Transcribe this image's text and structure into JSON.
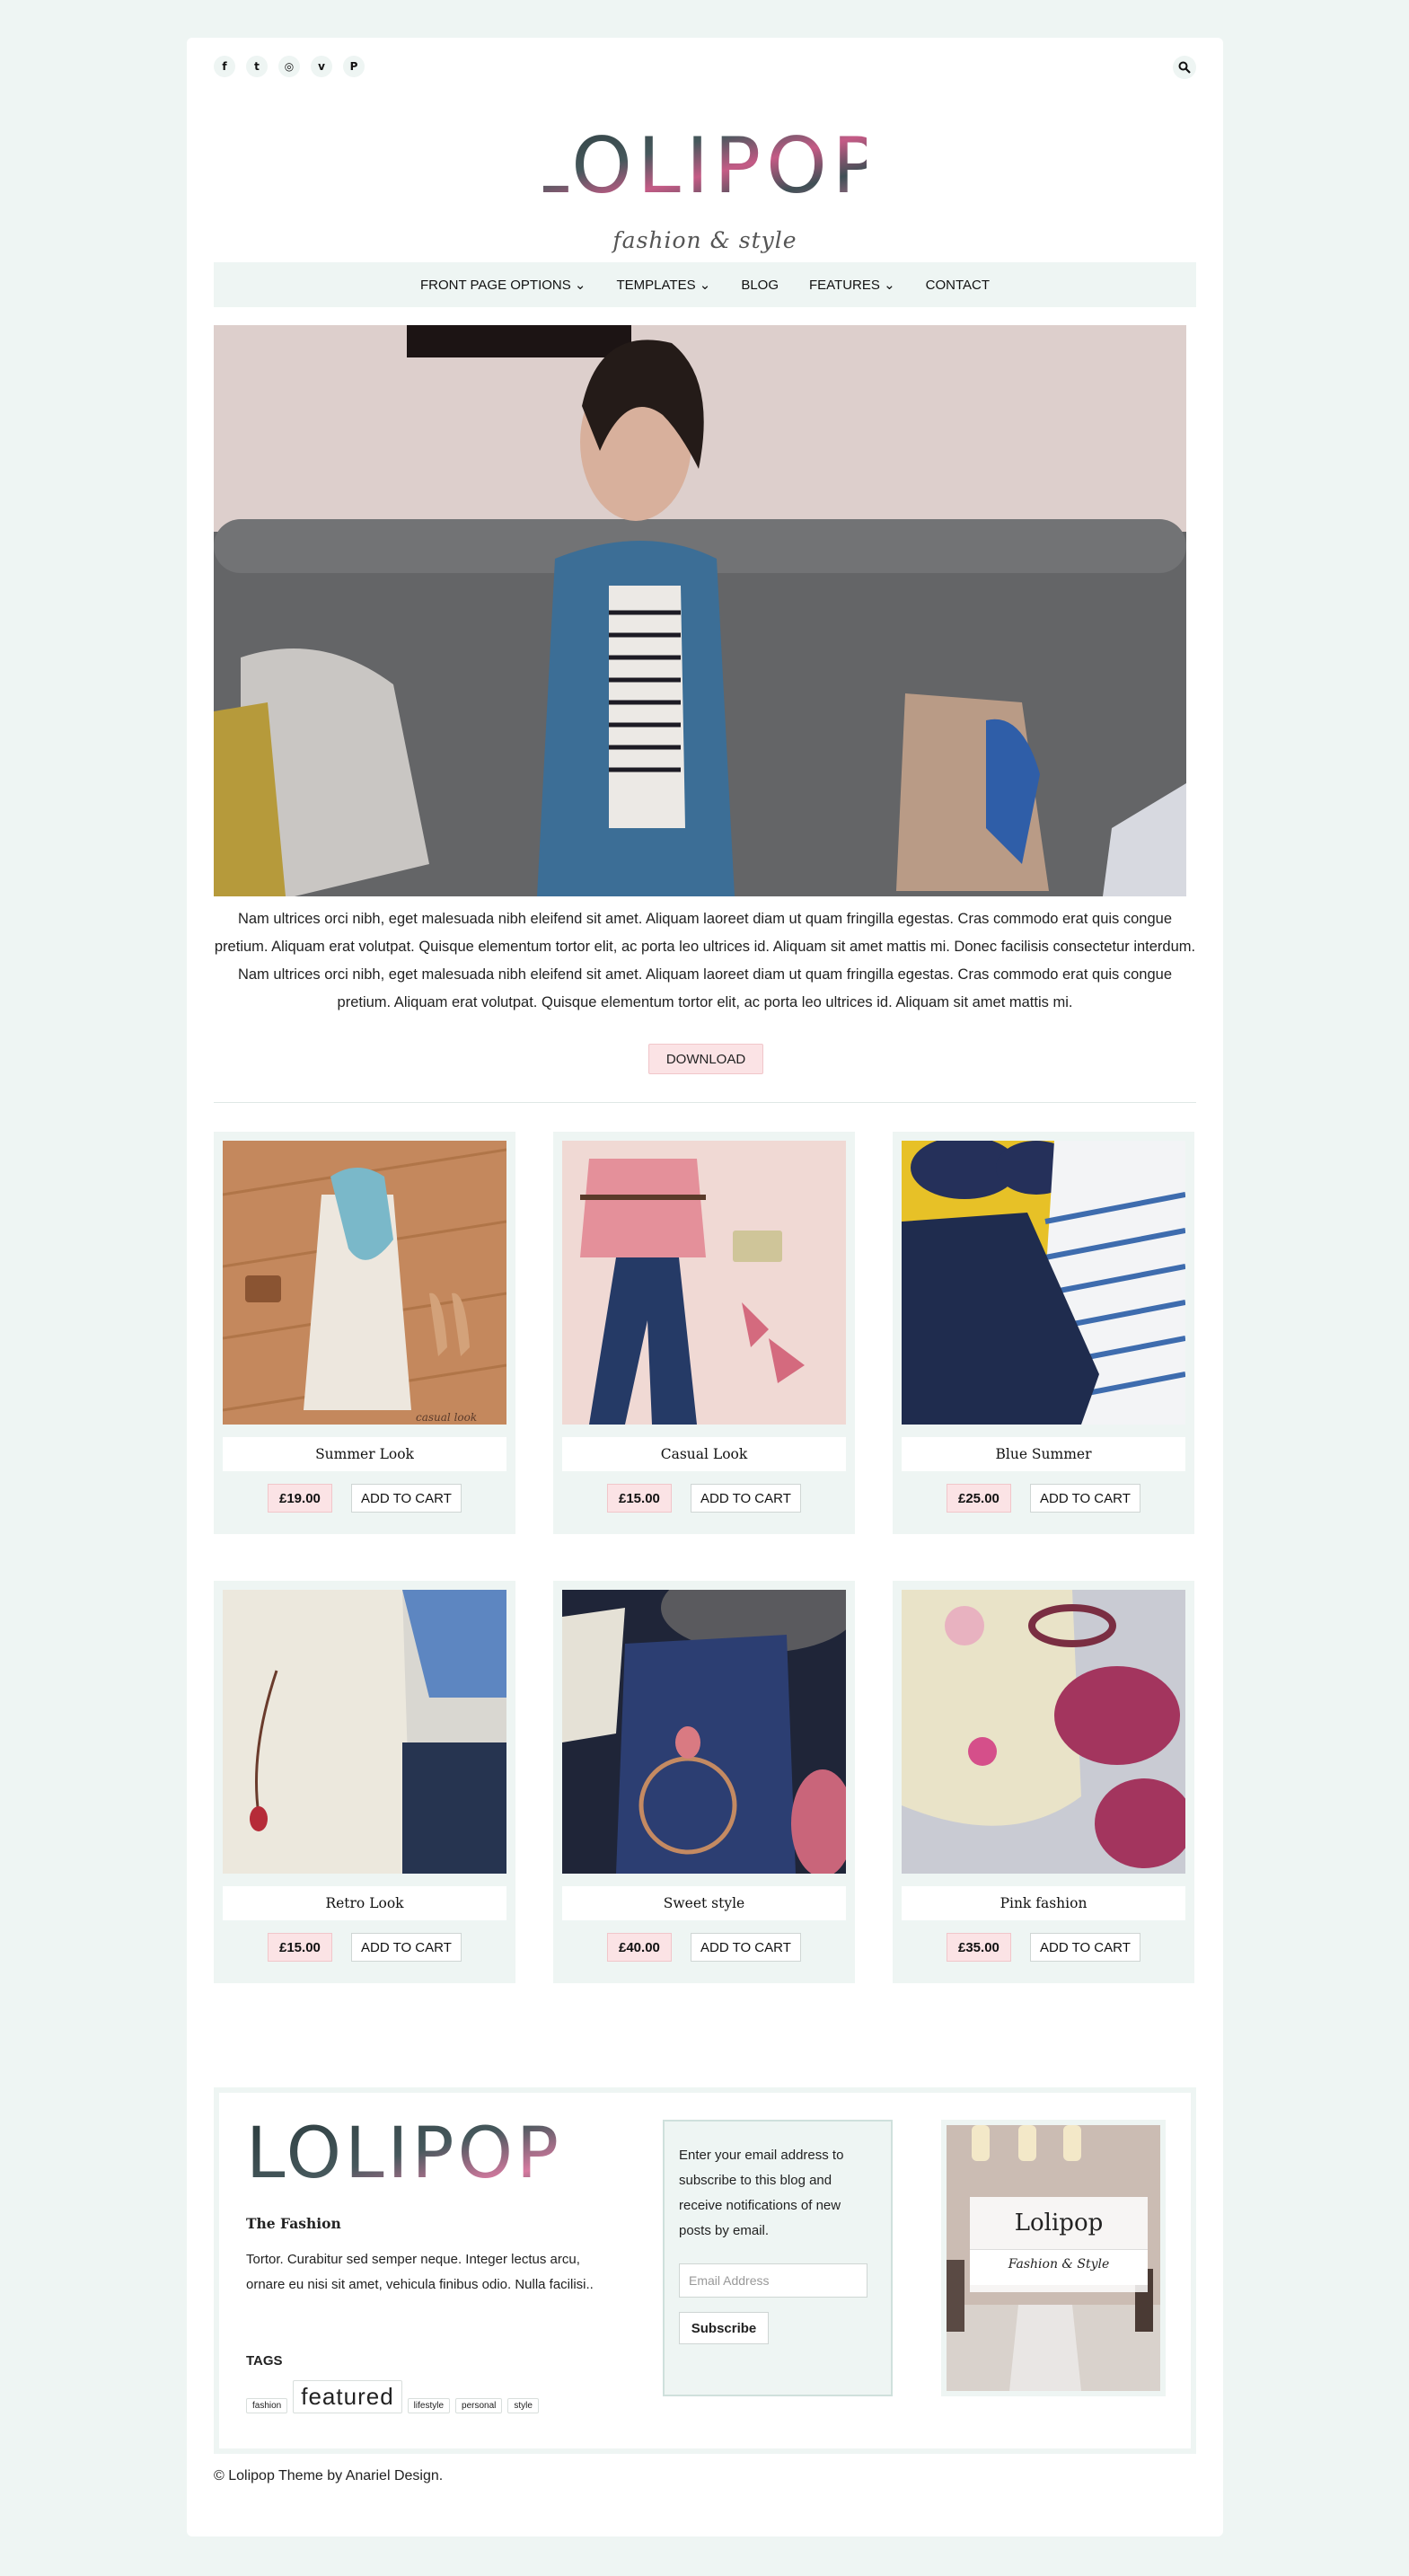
{
  "social": {
    "icons": [
      "facebook-icon",
      "twitter-icon",
      "instagram-icon",
      "vimeo-icon",
      "pinterest-icon"
    ],
    "glyphs": [
      "f",
      "t",
      "◎",
      "v",
      "P"
    ]
  },
  "logo": {
    "main": "LOLIPOP",
    "sub": "fashion & style"
  },
  "nav": {
    "items": [
      "FRONT PAGE OPTIONS ⌄",
      "TEMPLATES ⌄",
      "BLOG",
      "FEATURES ⌄",
      "CONTACT"
    ]
  },
  "hero": {
    "text": "Nam ultrices orci nibh, eget malesuada nibh eleifend sit amet. Aliquam laoreet diam ut quam fringilla egestas. Cras commodo erat quis congue pretium. Aliquam erat volutpat. Quisque elementum tortor elit, ac porta leo ultrices id. Aliquam sit amet mattis mi. Donec facilisis consectetur interdum. Nam ultrices orci nibh, eget malesuada nibh eleifend sit amet. Aliquam laoreet diam ut quam fringilla egestas. Cras commodo erat quis congue pretium. Aliquam erat volutpat. Quisque elementum tortor elit, ac porta leo ultrices id. Aliquam sit amet mattis mi.",
    "button": "DOWNLOAD"
  },
  "products": [
    {
      "title": "Summer Look",
      "price": "£19.00",
      "cart": "ADD TO CART",
      "watermark": "casual look"
    },
    {
      "title": "Casual Look",
      "price": "£15.00",
      "cart": "ADD TO CART"
    },
    {
      "title": "Blue Summer",
      "price": "£25.00",
      "cart": "ADD TO CART"
    },
    {
      "title": "Retro Look",
      "price": "£15.00",
      "cart": "ADD TO CART"
    },
    {
      "title": "Sweet style",
      "price": "£40.00",
      "cart": "ADD TO CART"
    },
    {
      "title": "Pink fashion",
      "price": "£35.00",
      "cart": "ADD TO CART"
    }
  ],
  "footer": {
    "logo": "LOLIPOP",
    "title": "The Fashion",
    "text": "Tortor. Curabitur sed semper neque. Integer lectus arcu, ornare eu nisi sit amet, vehicula finibus odio. Nulla facilisi..",
    "tags_heading": "TAGS",
    "tags": [
      "fashion",
      "featured",
      "lifestyle",
      "personal",
      "style"
    ],
    "subscribe_text": "Enter your email address to subscribe to this blog and receive notifications of new posts by email.",
    "email_placeholder": "Email Address",
    "subscribe_button": "Subscribe",
    "widget_title": "Lolipop",
    "widget_sub": "Fashion & Style",
    "copyright": "© Lolipop Theme by Anariel Design."
  },
  "colors": {
    "accent_pink": "#fbe3e5",
    "mint": "#eef5f3"
  }
}
